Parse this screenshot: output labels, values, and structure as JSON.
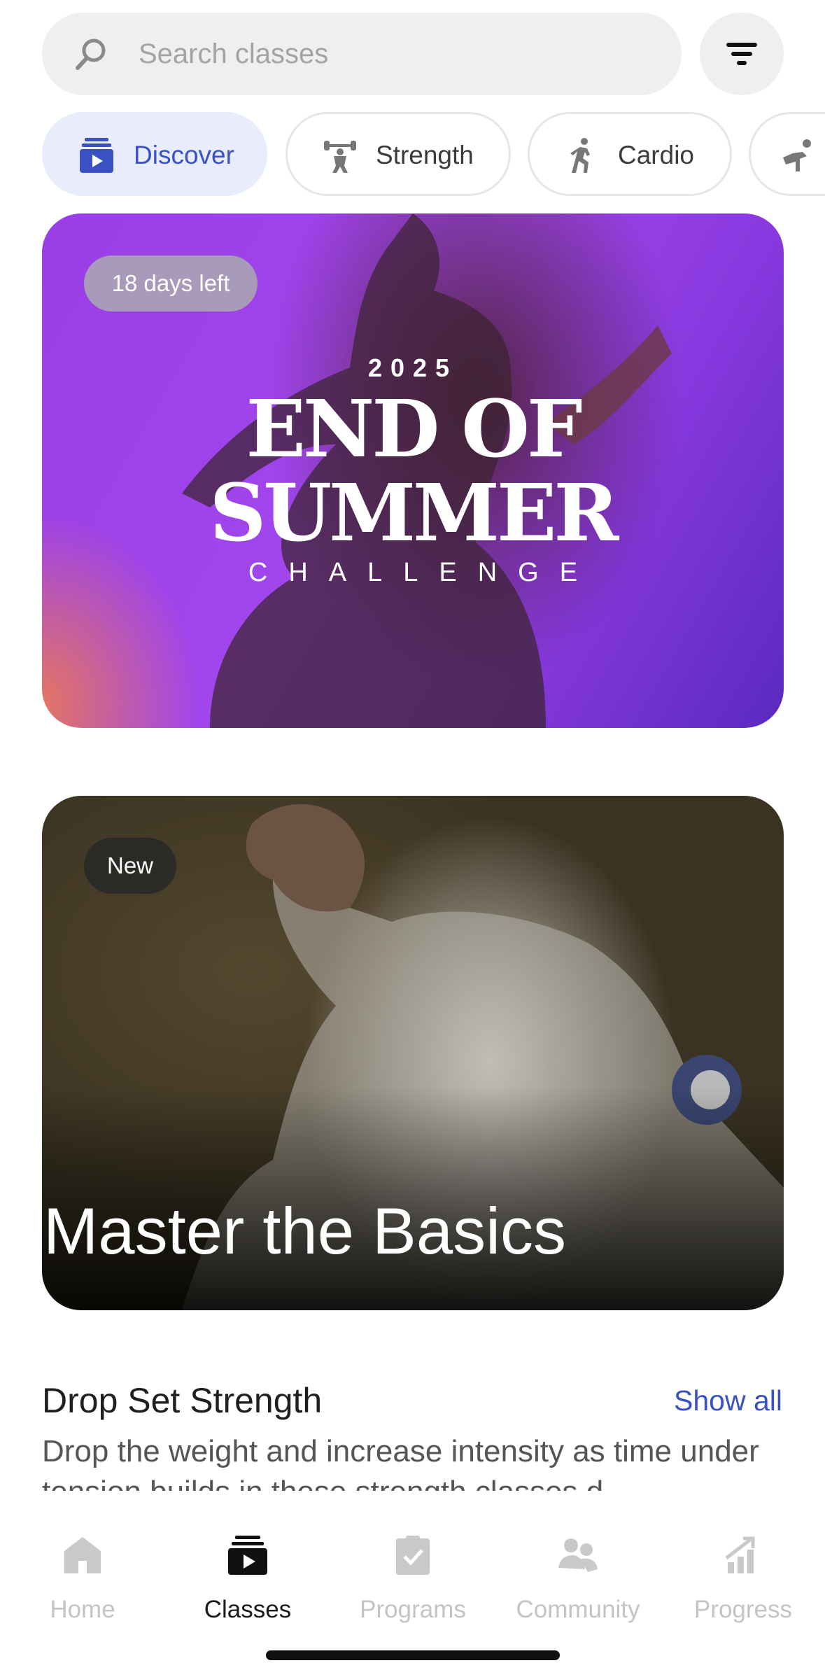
{
  "search": {
    "placeholder": "Search classes",
    "icon": "search-icon"
  },
  "filter": {
    "icon": "filter-icon"
  },
  "categories": [
    {
      "label": "Discover",
      "icon": "play-stack-icon",
      "active": true
    },
    {
      "label": "Strength",
      "icon": "weightlifter-icon",
      "active": false
    },
    {
      "label": "Cardio",
      "icon": "runner-icon",
      "active": false
    },
    {
      "label": "",
      "icon": "stretch-icon",
      "active": false
    }
  ],
  "featured": {
    "badge": "18 days left",
    "year": "2025",
    "title_line1": "END OF",
    "title_line2": "SUMMER",
    "subtitle": "CHALLENGE"
  },
  "collection": {
    "badge": "New",
    "title": "Master the Basics"
  },
  "section": {
    "title": "Drop Set Strength",
    "show_all": "Show all",
    "description": "Drop the weight and increase intensity as time under tension builds in these strength classes d"
  },
  "nav": [
    {
      "label": "Home",
      "icon": "home-icon",
      "active": false
    },
    {
      "label": "Classes",
      "icon": "play-stack-icon",
      "active": true
    },
    {
      "label": "Programs",
      "icon": "clipboard-check-icon",
      "active": false
    },
    {
      "label": "Community",
      "icon": "people-icon",
      "active": false
    },
    {
      "label": "Progress",
      "icon": "chart-arrow-icon",
      "active": false
    }
  ],
  "colors": {
    "accent": "#3a51c4",
    "chip_active_bg": "#e9ecfc",
    "inactive_nav": "#c4c4c4"
  }
}
